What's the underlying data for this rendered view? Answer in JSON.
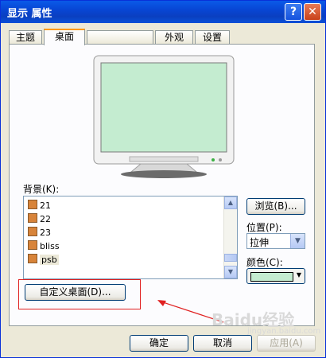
{
  "window": {
    "title": "显示 属性",
    "help": "?",
    "close": "✕"
  },
  "tabs": [
    "主题",
    "桌面",
    "",
    "外观",
    "设置"
  ],
  "background_label": "背景(K):",
  "backgrounds": [
    "21",
    "22",
    "23",
    "bliss",
    "psb"
  ],
  "selected_background": "psb",
  "browse_label": "浏览(B)...",
  "position_label": "位置(P):",
  "position_value": "拉伸",
  "color_label": "颜色(C):",
  "color_value": "#c4ecd0",
  "customize_label": "自定义桌面(D)...",
  "buttons": {
    "ok": "确定",
    "cancel": "取消",
    "apply": "应用(A)"
  },
  "watermark": "Baidu经验",
  "watermark_sub": "jingyan.baidu.com"
}
